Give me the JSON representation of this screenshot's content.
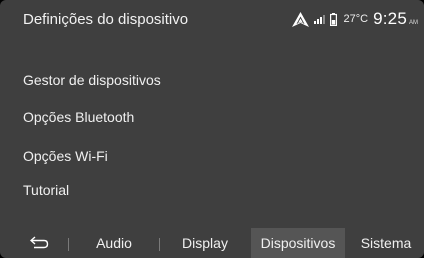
{
  "header": {
    "title": "Definições do dispositivo"
  },
  "status": {
    "temperature": "27°C",
    "time": "9:25",
    "ampm": "AM",
    "icons": [
      "navigation-arrow-icon",
      "signal-icon",
      "battery-icon"
    ]
  },
  "menu": {
    "items": [
      {
        "label": "Gestor de dispositivos"
      },
      {
        "label": "Opções Bluetooth"
      },
      {
        "label": "Opções Wi-Fi"
      },
      {
        "label": "Tutorial"
      }
    ]
  },
  "tabbar": {
    "back_icon": "back-arrow-icon",
    "tabs": [
      {
        "label": "Audio",
        "active": false
      },
      {
        "label": "Display",
        "active": false
      },
      {
        "label": "Dispositivos",
        "active": true
      },
      {
        "label": "Sistema",
        "active": false
      }
    ]
  },
  "colors": {
    "background": "#3f3f3f",
    "text": "#ffffff",
    "active_tab": "#555555"
  }
}
